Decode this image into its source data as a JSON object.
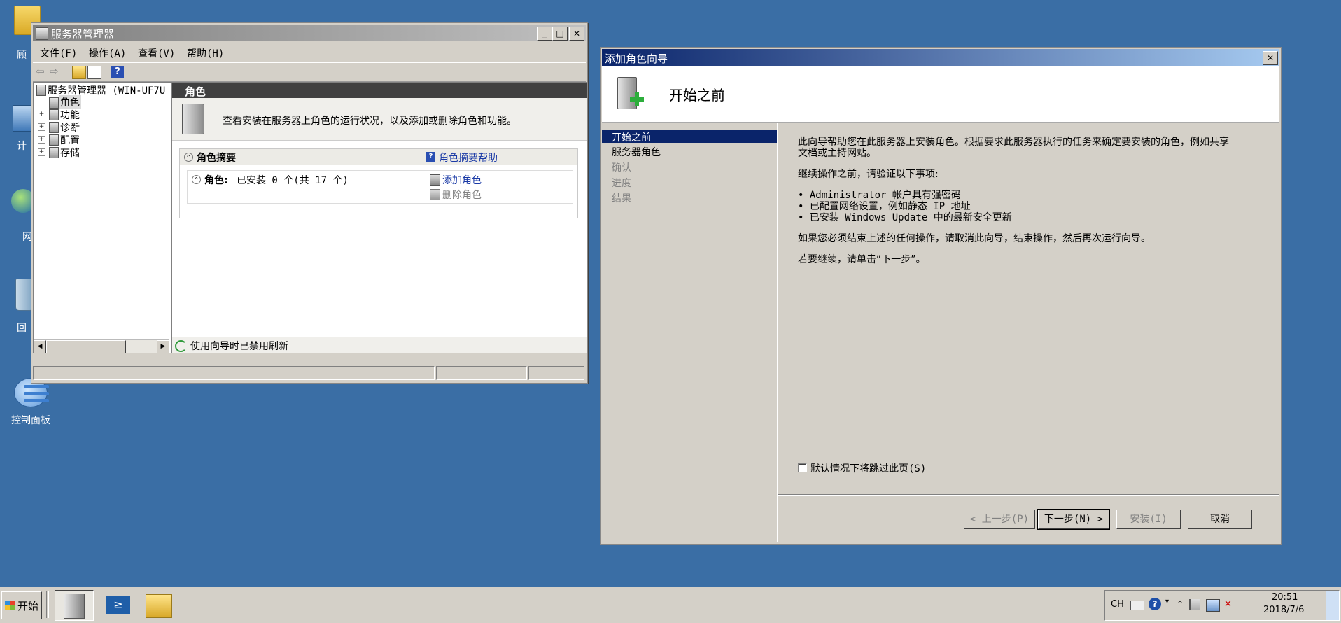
{
  "desktop": {
    "icons": [
      {
        "label": "顾"
      },
      {
        "label": "计"
      },
      {
        "label": "网"
      },
      {
        "label": "回"
      },
      {
        "label": "控制面板"
      }
    ]
  },
  "server_manager": {
    "title": "服务器管理器",
    "menu": [
      "文件(F)",
      "操作(A)",
      "查看(V)",
      "帮助(H)"
    ],
    "tree": {
      "root": "服务器管理器 (WIN-UF7U",
      "items": [
        "角色",
        "功能",
        "诊断",
        "配置",
        "存储"
      ]
    },
    "main": {
      "header": "角色",
      "description": "查看安装在服务器上角色的运行状况，以及添加或删除角色和功能。",
      "summary_title": "角色摘要",
      "summary_help": "角色摘要帮助",
      "roles_label": "角色:",
      "roles_count": "已安装 0 个(共 17 个)",
      "add_role": "添加角色",
      "remove_role": "删除角色",
      "status": "使用向导时已禁用刷新"
    }
  },
  "wizard": {
    "title": "添加角色向导",
    "heading": "开始之前",
    "steps": [
      {
        "label": "开始之前",
        "state": "active"
      },
      {
        "label": "服务器角色",
        "state": "enabled"
      },
      {
        "label": "确认",
        "state": "disabled"
      },
      {
        "label": "进度",
        "state": "disabled"
      },
      {
        "label": "结果",
        "state": "disabled"
      }
    ],
    "intro_line1": "此向导帮助您在此服务器上安装角色。根据要求此服务器执行的任务来确定要安装的角色，例如共享",
    "intro_line2": "文档或主持网站。",
    "verify_title": "继续操作之前，请验证以下事项:",
    "bullets": [
      "• Administrator 帐户具有强密码",
      "• 已配置网络设置，例如静态 IP 地址",
      "• 已安装 Windows Update 中的最新安全更新"
    ],
    "cancel_note": "如果您必须结束上述的任何操作，请取消此向导，结束操作，然后再次运行向导。",
    "continue_note": "若要继续，请单击“下一步”。",
    "skip_checkbox": "默认情况下将跳过此页(S)",
    "buttons": {
      "prev": "< 上一步(P)",
      "next": "下一步(N) >",
      "install": "安装(I)",
      "cancel": "取消"
    }
  },
  "taskbar": {
    "start": "开始",
    "lang": "CH",
    "time": "20:51",
    "date": "2018/7/6"
  }
}
